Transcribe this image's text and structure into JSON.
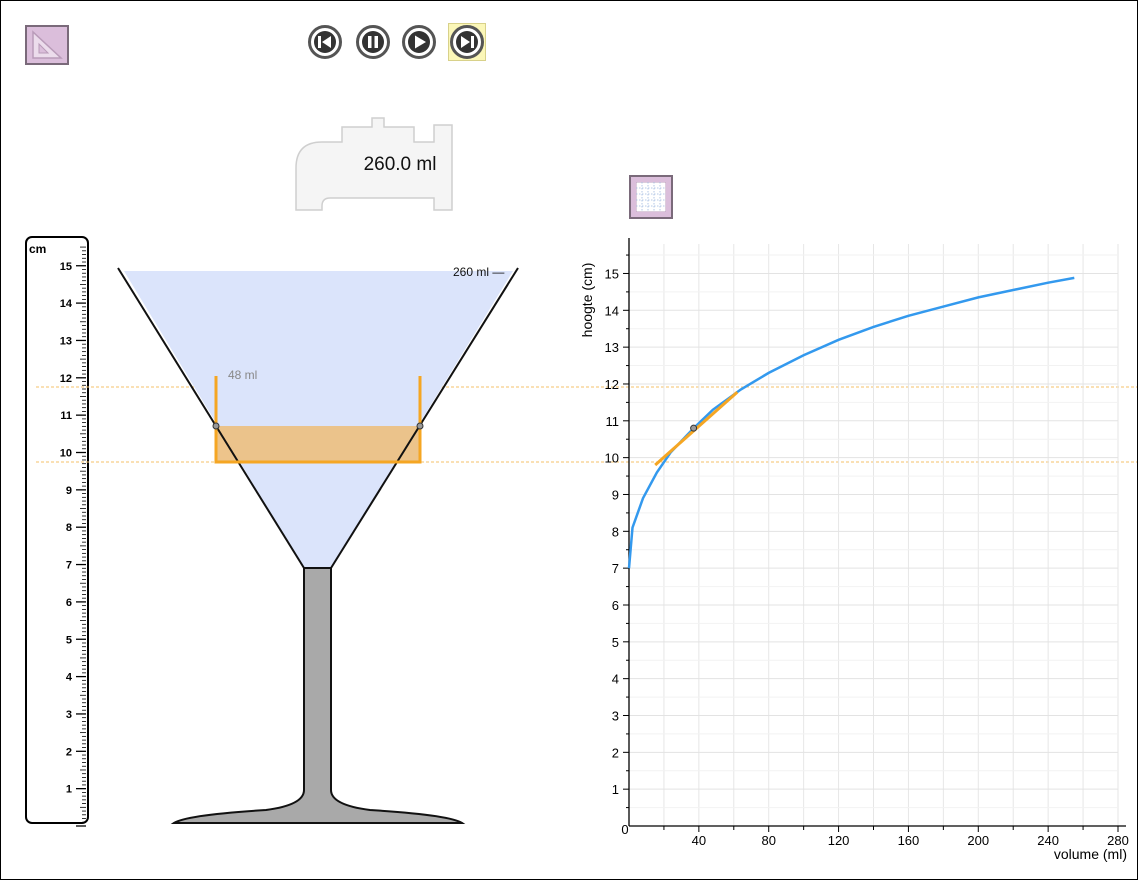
{
  "toolbar": {
    "mode_icon": "triangle-ruler-icon",
    "playback": [
      {
        "name": "skip-to-start-button",
        "icon": "skip-start-icon",
        "active": false
      },
      {
        "name": "pause-button",
        "icon": "pause-icon",
        "active": false
      },
      {
        "name": "play-button",
        "icon": "play-icon",
        "active": false
      },
      {
        "name": "skip-to-end-button",
        "icon": "skip-end-icon",
        "active": true
      }
    ],
    "grid_toggle_icon": "grid-icon"
  },
  "tap": {
    "volume_label": "260.0 ml"
  },
  "ruler": {
    "unit": "cm",
    "ticks": [
      "1",
      "2",
      "3",
      "4",
      "5",
      "6",
      "7",
      "8",
      "9",
      "10",
      "11",
      "12",
      "13",
      "14",
      "15"
    ]
  },
  "glass": {
    "full_label": "260 ml —",
    "selection_label": "48 ml",
    "selection_bottom_cm": 9.75,
    "selection_top_cm": 11.75,
    "liquid_level_cm": 10.8,
    "fill_level_cm": 15
  },
  "chart_data": {
    "type": "line",
    "xlabel": "volume (ml)",
    "ylabel": "hoogte (cm)",
    "xlim": [
      0,
      280
    ],
    "ylim": [
      0,
      15.8
    ],
    "x_ticks": [
      "0",
      "40",
      "80",
      "120",
      "160",
      "200",
      "240",
      "280"
    ],
    "y_ticks": [
      "1",
      "2",
      "3",
      "4",
      "5",
      "6",
      "7",
      "8",
      "9",
      "10",
      "11",
      "12",
      "13",
      "14",
      "15"
    ],
    "grid": true,
    "series": [
      {
        "color": "#3399ee",
        "points": [
          [
            0,
            7.0
          ],
          [
            2,
            8.1
          ],
          [
            8,
            8.9
          ],
          [
            16,
            9.6
          ],
          [
            24,
            10.15
          ],
          [
            32,
            10.55
          ],
          [
            37,
            10.8
          ],
          [
            48,
            11.3
          ],
          [
            64,
            11.85
          ],
          [
            80,
            12.3
          ],
          [
            100,
            12.78
          ],
          [
            120,
            13.2
          ],
          [
            140,
            13.55
          ],
          [
            160,
            13.85
          ],
          [
            180,
            14.1
          ],
          [
            200,
            14.35
          ],
          [
            220,
            14.55
          ],
          [
            240,
            14.75
          ],
          [
            255,
            14.88
          ]
        ]
      }
    ],
    "tangent": {
      "color": "#f5a623",
      "from": [
        15,
        9.8
      ],
      "to": [
        62,
        11.78
      ],
      "point": [
        37,
        10.8
      ]
    },
    "reference_lines_cm": [
      9.75,
      11.75
    ]
  },
  "colors": {
    "accent": "#f5a623",
    "water": "#dbe4fb",
    "liquid_selected": "#ecc185",
    "curve": "#3399ee",
    "stem": "#a9a9a9"
  }
}
